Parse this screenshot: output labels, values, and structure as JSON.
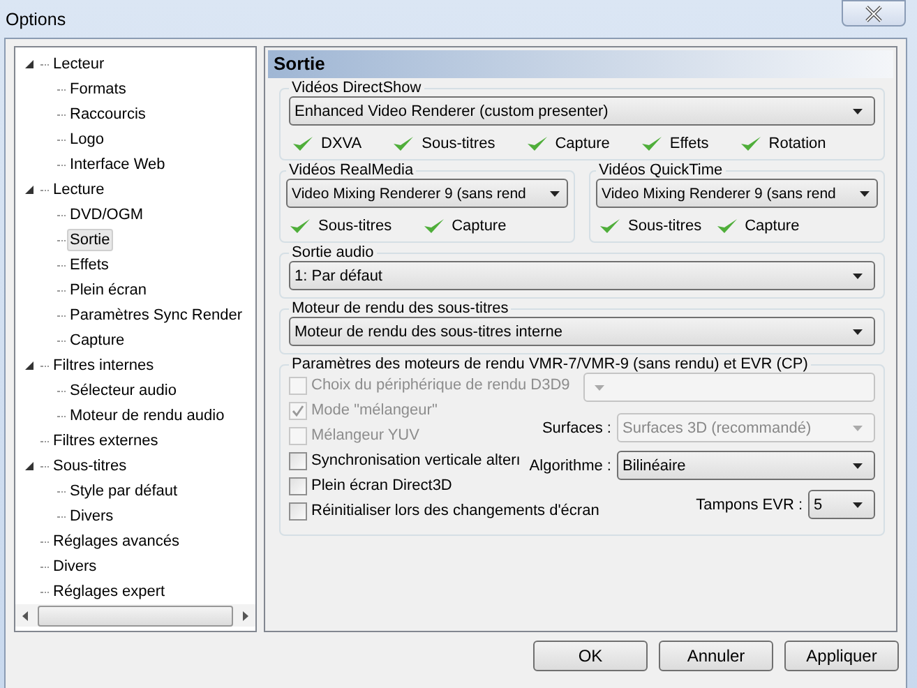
{
  "window": {
    "title": "Options"
  },
  "tree": [
    {
      "label": "Lecteur",
      "expanded": true,
      "selected": false,
      "children": [
        {
          "label": "Formats",
          "selected": false
        },
        {
          "label": "Raccourcis",
          "selected": false
        },
        {
          "label": "Logo",
          "selected": false
        },
        {
          "label": "Interface Web",
          "selected": false
        }
      ]
    },
    {
      "label": "Lecture",
      "expanded": true,
      "selected": false,
      "children": [
        {
          "label": "DVD/OGM",
          "selected": false
        },
        {
          "label": "Sortie",
          "selected": true
        },
        {
          "label": "Effets",
          "selected": false
        },
        {
          "label": "Plein écran",
          "selected": false
        },
        {
          "label": "Paramètres Sync Render",
          "selected": false
        },
        {
          "label": "Capture",
          "selected": false
        }
      ]
    },
    {
      "label": "Filtres internes",
      "expanded": true,
      "selected": false,
      "children": [
        {
          "label": "Sélecteur audio",
          "selected": false
        },
        {
          "label": "Moteur de rendu audio",
          "selected": false
        }
      ]
    },
    {
      "label": "Filtres externes",
      "selected": false
    },
    {
      "label": "Sous-titres",
      "expanded": true,
      "selected": false,
      "children": [
        {
          "label": "Style par défaut",
          "selected": false
        },
        {
          "label": "Divers",
          "selected": false
        }
      ]
    },
    {
      "label": "Réglages avancés",
      "selected": false
    },
    {
      "label": "Divers",
      "selected": false
    },
    {
      "label": "Réglages expert",
      "selected": false
    }
  ],
  "page_title": "Sortie",
  "directshow": {
    "title": "Vidéos DirectShow",
    "value": "Enhanced Video Renderer (custom presenter)",
    "features": [
      {
        "label": "DXVA",
        "supported": true
      },
      {
        "label": "Sous-titres",
        "supported": true
      },
      {
        "label": "Capture",
        "supported": true
      },
      {
        "label": "Effets",
        "supported": true
      },
      {
        "label": "Rotation",
        "supported": true
      }
    ]
  },
  "realmedia": {
    "title": "Vidéos RealMedia",
    "value": "Video Mixing Renderer 9 (sans rend",
    "features": [
      {
        "label": "Sous-titres",
        "supported": true
      },
      {
        "label": "Capture",
        "supported": true
      }
    ]
  },
  "quicktime": {
    "title": "Vidéos QuickTime",
    "value": "Video Mixing Renderer 9 (sans rend",
    "features": [
      {
        "label": "Sous-titres",
        "supported": true
      },
      {
        "label": "Capture",
        "supported": true
      }
    ]
  },
  "audio": {
    "title": "Sortie audio",
    "value": "1: Par défaut"
  },
  "subtitles": {
    "title": "Moteur de rendu des sous-titres",
    "value": "Moteur de rendu des sous-titres interne"
  },
  "vmr": {
    "title": "Paramètres des moteurs de rendu VMR-7/VMR-9 (sans rendu) et EVR (CP)",
    "options": [
      {
        "label": "Choix du périphérique de rendu D3D9",
        "checked": false,
        "disabled": true
      },
      {
        "label": "Mode \"mélangeur\"",
        "checked": true,
        "disabled": true
      },
      {
        "label": "Mélangeur YUV",
        "checked": false,
        "disabled": true
      },
      {
        "label": "Synchronisation verticale alterı",
        "checked": false,
        "disabled": false
      },
      {
        "label": "Plein écran Direct3D",
        "checked": false,
        "disabled": false
      },
      {
        "label": "Réinitialiser lors des changements d'écran",
        "checked": false,
        "disabled": false
      }
    ],
    "device": {
      "disabled": true
    },
    "surfaces": {
      "label": "Surfaces :",
      "value": "Surfaces 3D (recommandé)",
      "disabled": true
    },
    "algorithm": {
      "label": "Algorithme :",
      "value": "Bilinéaire",
      "disabled": false
    },
    "evr_buffers": {
      "label": "Tampons EVR :",
      "value": "5",
      "disabled": false
    }
  },
  "buttons": [
    "OK",
    "Annuler",
    "Appliquer"
  ]
}
